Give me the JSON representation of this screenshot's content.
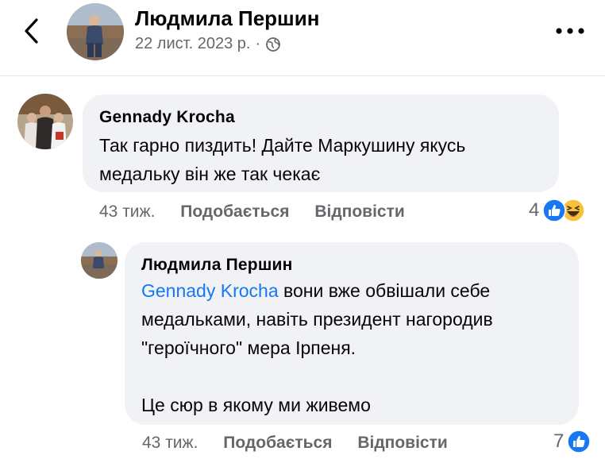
{
  "post": {
    "author": "Людмила Першин",
    "date": "22 лист. 2023 р.",
    "separator": "·"
  },
  "comments": [
    {
      "author": "Gennady  Krocha",
      "text_lines": [
        "Так гарно пиздить! Дайте Маркушину якусь",
        "медальку він же так чекає"
      ],
      "time": "43 тиж.",
      "like_label": "Подобається",
      "reply_label": "Відповісти",
      "reaction_count": "4",
      "reactions": [
        "like-icon",
        "haha-icon"
      ]
    },
    {
      "author": "Людмила Першин",
      "mention": "Gennady  Krocha",
      "text_line1_rest": " вони вже обвішали себе",
      "text_lines": [
        "медальками, навіть президент нагородив",
        "\"героїчного\" мера Ірпеня.",
        "",
        "Це сюр в якому ми живемо"
      ],
      "time": "43 тиж.",
      "like_label": "Подобається",
      "reply_label": "Відповісти",
      "reaction_count": "7",
      "reactions": [
        "like-icon"
      ]
    }
  ],
  "colors": {
    "accent": "#1877f2",
    "bubble": "#f0f2f5",
    "secondary_text": "#65676b"
  }
}
